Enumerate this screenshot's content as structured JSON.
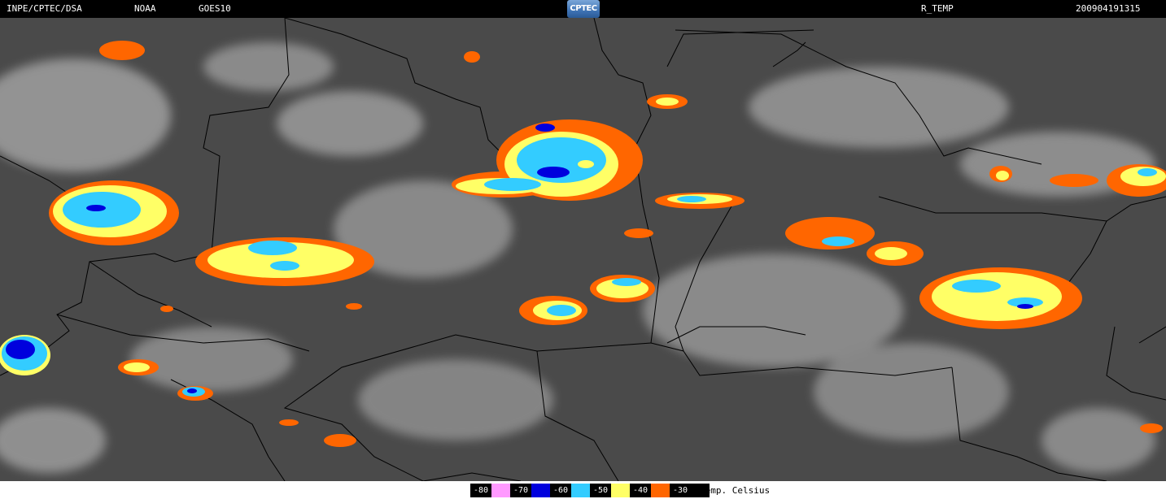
{
  "header": {
    "agency": "INPE/CPTEC/DSA",
    "noaa": "NOAA",
    "satellite": "GOES10",
    "logo": "CPTEC",
    "product": "R_TEMP",
    "timestamp": "200904191315"
  },
  "legend": {
    "unit_label": "Temp. Celsius",
    "entries": [
      {
        "label": "-80",
        "color": "#ff99ff"
      },
      {
        "label": "-70",
        "color": "#0000dd"
      },
      {
        "label": "-60",
        "color": "#33ccff"
      },
      {
        "label": "-50",
        "color": "#ffff66"
      },
      {
        "label": "-40",
        "color": "#ff6600"
      },
      {
        "label": "-30",
        "color": "#000000"
      }
    ]
  },
  "map": {
    "background_color": "#4a4a4a",
    "cloud_color": "#bdbdbd",
    "border_color": "#000000"
  }
}
